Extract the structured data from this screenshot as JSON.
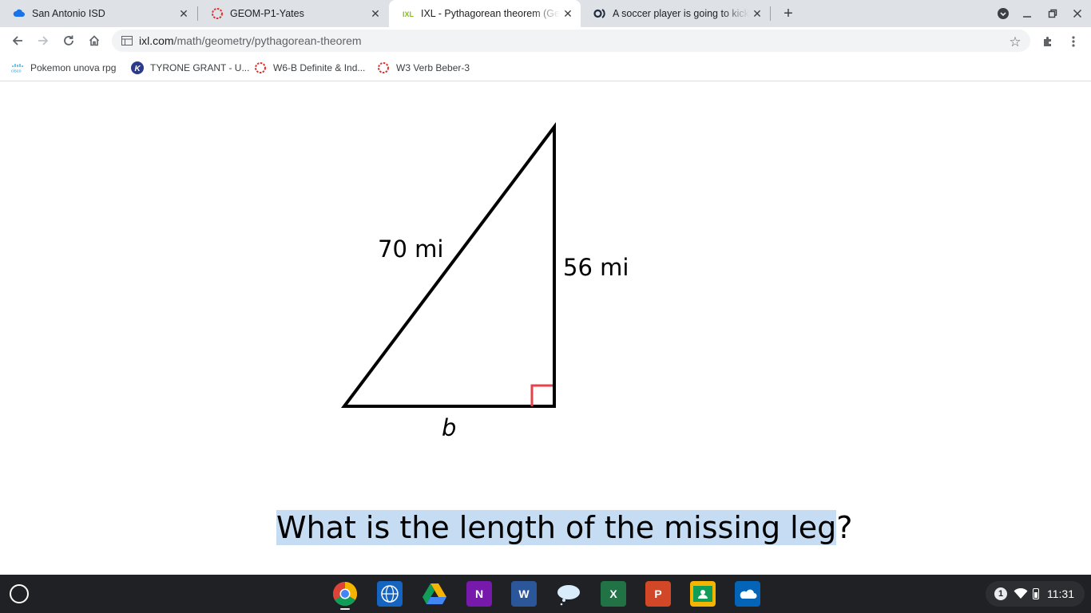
{
  "tabs": [
    {
      "title": "San Antonio ISD",
      "icon": "cloud-icon"
    },
    {
      "title": "GEOM-P1-Yates",
      "icon": "canvas-icon"
    },
    {
      "title": "IXL - Pythagorean theorem (Geometry)",
      "icon": "ixl-icon",
      "active": true
    },
    {
      "title": "A soccer player is going to kick a",
      "icon": "brainly-icon"
    }
  ],
  "address_bar": {
    "domain": "ixl.com",
    "path": "/math/geometry/pythagorean-theorem"
  },
  "bookmarks": [
    {
      "label": "Pokemon unova rpg",
      "icon": "cisco-icon"
    },
    {
      "label": "TYRONE GRANT - U...",
      "icon": "k-circle-icon"
    },
    {
      "label": "W6-B Definite & Ind...",
      "icon": "canvas-icon"
    },
    {
      "label": "W3 Verb Beber-3",
      "icon": "canvas-icon"
    }
  ],
  "problem": {
    "hypotenuse_label": "70 mi",
    "vertical_leg_label": "56 mi",
    "missing_leg_label": "b",
    "question_highlighted": "What is the length of the missing leg",
    "question_tail": "?"
  },
  "shelf": {
    "apps": [
      "chrome-icon",
      "web-icon",
      "drive-icon",
      "onenote-icon",
      "word-icon",
      "weather-icon",
      "excel-icon",
      "powerpoint-icon",
      "classroom-icon",
      "onedrive-icon"
    ],
    "notification_count": "1",
    "time": "11:31"
  },
  "colors": {
    "right_angle_marker": "#e8434b",
    "selection_highlight": "#c6dcf3"
  }
}
